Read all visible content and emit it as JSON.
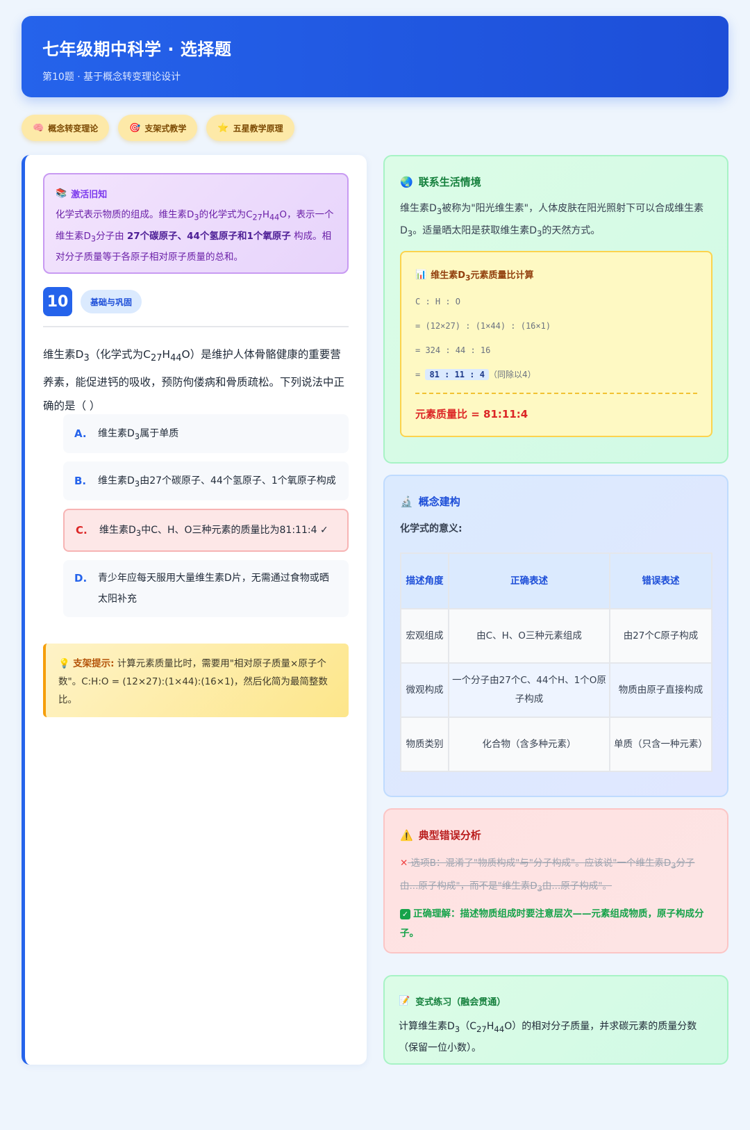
{
  "header": {
    "title": "七年级期中科学 · 选择题",
    "subtitle": "第10题 · 基于概念转变理论设计"
  },
  "tags": [
    {
      "icon": "brain-icon",
      "glyph": "🧠",
      "label": "概念转变理论"
    },
    {
      "icon": "target-icon",
      "glyph": "🎯",
      "label": "支架式教学"
    },
    {
      "icon": "star-icon",
      "glyph": "⭐",
      "label": "五星教学原理"
    }
  ],
  "activate": {
    "title": "激活旧知",
    "text_1": "化学式表示物质的组成。维生素D",
    "sub_1": "3",
    "text_2": "的化学式为C",
    "sub_2": "27",
    "text_3": "H",
    "sub_3": "44",
    "text_4": "O，表示一个维生素D",
    "sub_4": "3",
    "text_5": "分子由 ",
    "strong": "27个碳原子、44个氢原子和1个氧原子",
    "text_6": " 构成。相对分子质量等于各原子相对原子质量的总和。"
  },
  "question": {
    "number": "10",
    "level": "基础与巩固",
    "stem_1": "维生素D",
    "stem_sub_1": "3",
    "stem_2": "（化学式为C",
    "stem_sub_2": "27",
    "stem_3": "H",
    "stem_sub_3": "44",
    "stem_4": "O）是维护人体骨骼健康的重要营养素，能促进钙的吸收，预防佝偻病和骨质疏松。下列说法中正确的是（  ）",
    "options": [
      {
        "letter": "A.",
        "pre": "维生素D",
        "sub": "3",
        "post": "属于单质"
      },
      {
        "letter": "B.",
        "pre": "维生素D",
        "sub": "3",
        "post": "由27个碳原子、44个氢原子、1个氧原子构成"
      },
      {
        "letter": "C.",
        "pre": "维生素D",
        "sub": "3",
        "post": "中C、H、O三种元素的质量比为81:11:4 ✓"
      },
      {
        "letter": "D.",
        "pre": "青少年应每天服用大量维生素D片，无需通过食物或晒太阳补充",
        "sub": "",
        "post": ""
      }
    ]
  },
  "hint": {
    "icon": "lightbulb-icon",
    "label": "支架提示:",
    "text": " 计算元素质量比时，需要用\"相对原子质量×原子个数\"。C:H:O = (12×27):(1×44):(16×1)，然后化简为最简整数比。"
  },
  "life": {
    "title": "联系生活情境",
    "p_1": "维生素D",
    "p_sub_1": "3",
    "p_2": "被称为\"阳光维生素\"，人体皮肤在阳光照射下可以合成维生素D",
    "p_sub_2": "3",
    "p_3": "。适量晒太阳是获取维生素D",
    "p_sub_3": "3",
    "p_4": "的天然方式。"
  },
  "calc": {
    "title_pre": "维生素D",
    "title_sub": "3",
    "title_post": "元素质量比计算",
    "lines": [
      "C : H : O",
      "= (12×27) : (1×44) : (16×1)",
      "= 324 : 44 : 16"
    ],
    "last_prefix": "= ",
    "last_highlight": "81 : 11 : 4",
    "last_note": "（同除以4）",
    "result": "元素质量比 = 81:11:4"
  },
  "concept": {
    "title": "概念建构",
    "subtitle": "化学式的意义:",
    "headers": [
      "描述角度",
      "正确表述",
      "错误表述"
    ],
    "rows": [
      [
        "宏观组成",
        "由C、H、O三种元素组成",
        "由27个C原子构成"
      ],
      [
        "微观构成",
        "一个分子由27个C、44个H、1个O原子构成",
        "物质由原子直接构成"
      ],
      [
        "物质类别",
        "化合物（含多种元素）",
        "单质（只含一种元素）"
      ]
    ]
  },
  "error": {
    "title": "典型错误分析",
    "wrong_1": " 选项B：混淆了\"物质构成\"与\"分子构成\"。应该说\"一个维生素D",
    "wrong_sub_1": "3",
    "wrong_2": "分子由...原子构成\"，而不是\"维生素D",
    "wrong_sub_2": "3",
    "wrong_3": "由...原子构成\"。",
    "right": "正确理解：描述物质组成时要注意层次——元素组成物质，原子构成分子。"
  },
  "practice": {
    "title": "变式练习（融会贯通）",
    "p_1": "计算维生素D",
    "p_sub_1": "3",
    "p_2": "（C",
    "p_sub_2": "27",
    "p_3": "H",
    "p_sub_3": "44",
    "p_4": "O）的相对分子质量，并求碳元素的质量分数（保留一位小数）。"
  },
  "colors": {
    "primary": "#2563eb",
    "correct": "#dc2626",
    "success": "#16a34a"
  }
}
